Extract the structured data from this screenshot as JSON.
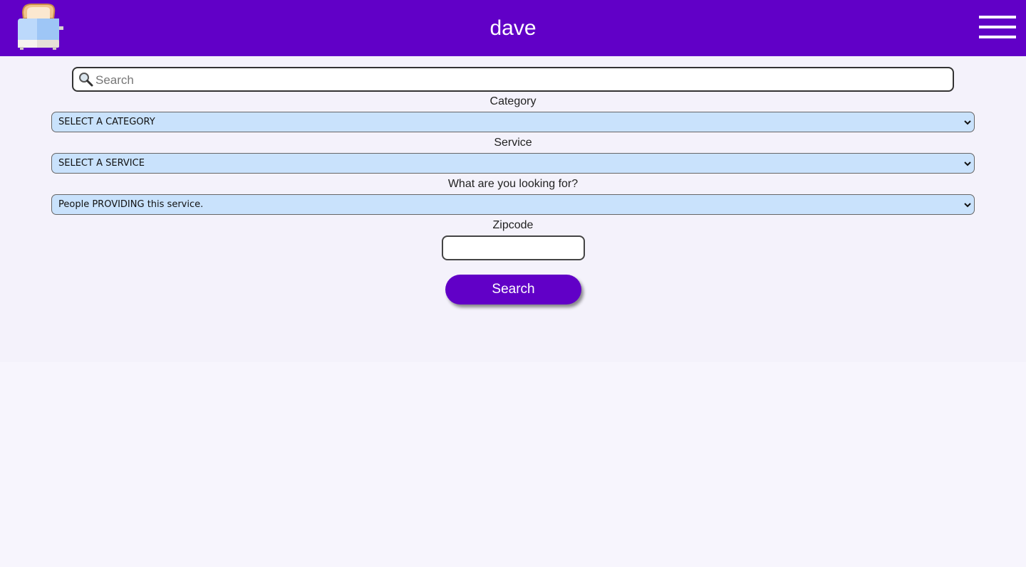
{
  "header": {
    "title": "dave",
    "logo_icon": "toaster-logo-icon",
    "menu_icon": "hamburger-menu-icon",
    "background_color": "#6100c7"
  },
  "search": {
    "placeholder": "Search",
    "value": "",
    "icon": "magnifier-icon"
  },
  "filters": {
    "category": {
      "label": "Category",
      "selected": "SELECT A CATEGORY"
    },
    "service": {
      "label": "Service",
      "selected": "SELECT A SERVICE"
    },
    "looking_for": {
      "label": "What are you looking for?",
      "selected": "People PROVIDING this service."
    },
    "zipcode": {
      "label": "Zipcode",
      "value": ""
    }
  },
  "actions": {
    "search_label": "Search"
  }
}
